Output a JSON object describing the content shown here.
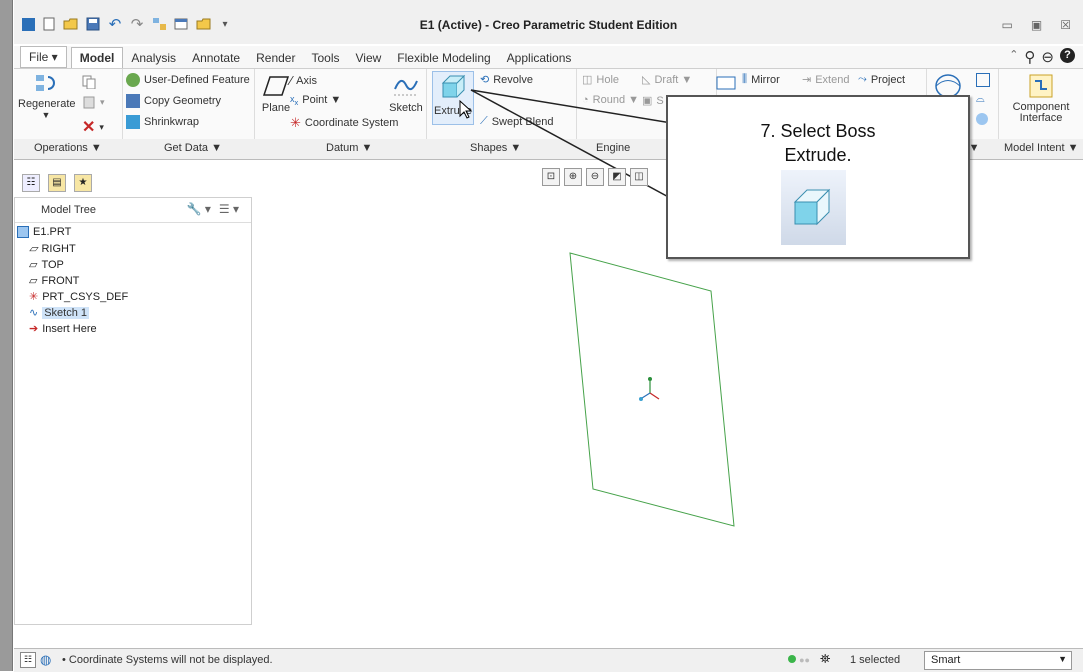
{
  "window": {
    "title": "E1 (Active) - Creo Parametric Student Edition",
    "controls": [
      "▭",
      "▣",
      "☒"
    ]
  },
  "quick_access": [
    "■",
    "▢",
    "📂",
    "💾",
    "↶",
    "↷",
    "⛶",
    "⊟",
    "📁",
    "▾"
  ],
  "menu_tabs": [
    "File ▾",
    "Model",
    "Analysis",
    "Annotate",
    "Render",
    "Tools",
    "View",
    "Flexible Modeling",
    "Applications"
  ],
  "active_tab": "Model",
  "ribbon": {
    "operations": {
      "regenerate": "Regenerate",
      "label": "Operations ▼"
    },
    "get_data": {
      "user_defined_feature": "User-Defined Feature",
      "copy_geometry": "Copy Geometry",
      "shrinkwrap": "Shrinkwrap",
      "label": "Get Data ▼"
    },
    "datum": {
      "plane": "Plane",
      "axis": "Axis",
      "point": "Point ▼",
      "coordinate_system": "Coordinate System",
      "sketch": "Sketch",
      "label": "Datum ▼"
    },
    "shapes": {
      "extrude": "Extrude",
      "revolve": "Revolve",
      "swept_blend": "Swept Blend",
      "label": "Shapes ▼"
    },
    "engineering": {
      "hole": "Hole",
      "draft": "Draft ▼",
      "round": "Round ▼",
      "s_partial": "S",
      "label": "Engine"
    },
    "editing": {
      "mirror": "Mirror",
      "extend": "Extend",
      "project": "Project"
    },
    "surfaces": {
      "y_partial": "y",
      "label": "es ▼"
    },
    "model_intent": {
      "component_interface": "Component Interface",
      "label": "Model Intent ▼"
    }
  },
  "callout": {
    "line1": "7. Select Boss",
    "line2": "Extrude."
  },
  "model_tree": {
    "title": "Model Tree",
    "items": [
      {
        "label": "E1.PRT"
      },
      {
        "label": "RIGHT"
      },
      {
        "label": "TOP"
      },
      {
        "label": "FRONT"
      },
      {
        "label": "PRT_CSYS_DEF"
      },
      {
        "label": "Sketch 1"
      },
      {
        "label": "Insert Here"
      }
    ]
  },
  "status": {
    "message": "Coordinate Systems will not be displayed.",
    "selected": "1 selected",
    "filter": "Smart"
  },
  "colors": {
    "sketch_plane": "#46a24a",
    "selection_highlight": "#cfe3f8",
    "icon_blue": "#2a6fb8"
  }
}
